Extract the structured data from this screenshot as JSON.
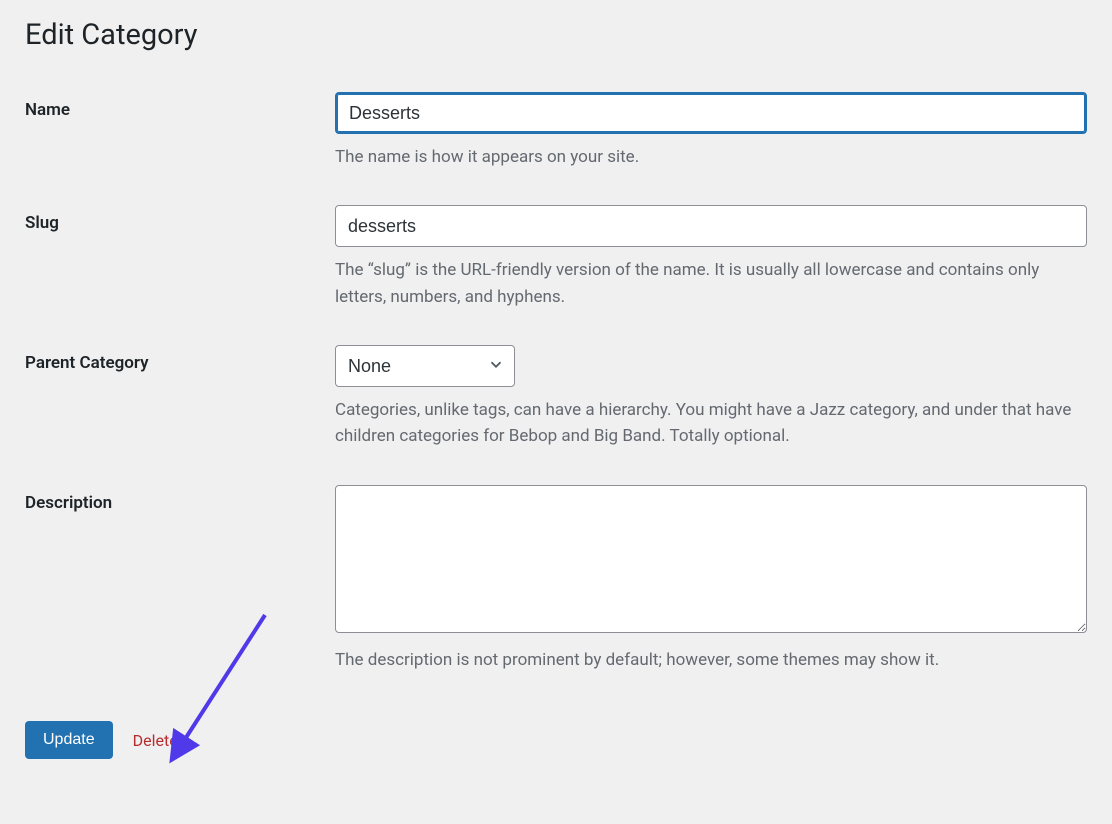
{
  "page_title": "Edit Category",
  "fields": {
    "name": {
      "label": "Name",
      "value": "Desserts",
      "help": "The name is how it appears on your site."
    },
    "slug": {
      "label": "Slug",
      "value": "desserts",
      "help": "The “slug” is the URL-friendly version of the name. It is usually all lowercase and contains only letters, numbers, and hyphens."
    },
    "parent": {
      "label": "Parent Category",
      "selected": "None",
      "help": "Categories, unlike tags, can have a hierarchy. You might have a Jazz category, and under that have children categories for Bebop and Big Band. Totally optional."
    },
    "description": {
      "label": "Description",
      "value": "",
      "help": "The description is not prominent by default; however, some themes may show it."
    }
  },
  "actions": {
    "update_label": "Update",
    "delete_label": "Delete"
  },
  "annotation": {
    "arrow_color": "#4f39e8"
  }
}
